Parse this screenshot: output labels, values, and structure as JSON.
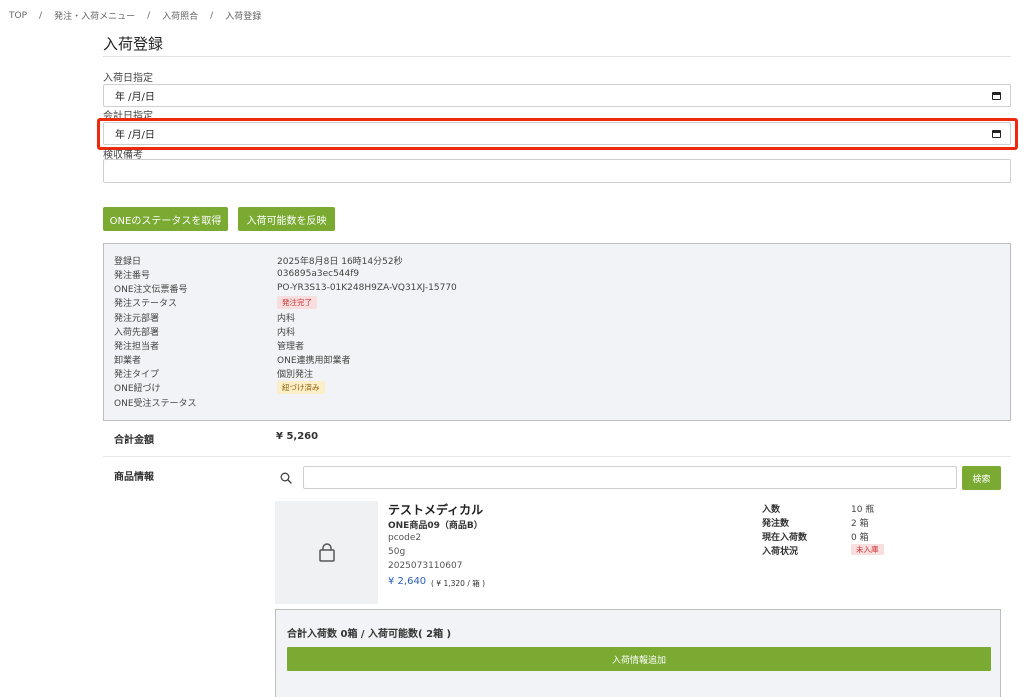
{
  "breadcrumb": {
    "items": [
      "TOP",
      "発注・入荷メニュー",
      "入荷照合",
      "入荷登録"
    ],
    "separator": "/"
  },
  "page": {
    "title": "入荷登録"
  },
  "form": {
    "arrival_date_label": "入荷日指定",
    "arrival_date_value": "年 /月/日",
    "accounting_date_label": "会計日指定",
    "accounting_date_value": "年 /月/日",
    "inspection_note_label": "検収備考",
    "inspection_note_value": ""
  },
  "actions": {
    "get_status_label": "ONEのステータスを取得",
    "reflect_label": "入荷可能数を反映"
  },
  "info": {
    "rows": [
      {
        "label": "登録日",
        "value": "2025年8月8日 16時14分52秒"
      },
      {
        "label": "発注番号",
        "value": "036895a3ec544f9"
      },
      {
        "label": "ONE注文伝票番号",
        "value": "PO-YR3S13-01K248H9ZA-VQ31XJ-15770"
      },
      {
        "label": "発注ステータス",
        "value": "発注完了"
      },
      {
        "label": "発注元部署",
        "value": "内科"
      },
      {
        "label": "入荷先部署",
        "value": "内科"
      },
      {
        "label": "発注担当者",
        "value": "管理者"
      },
      {
        "label": "卸業者",
        "value": "ONE連携用卸業者"
      },
      {
        "label": "発注タイプ",
        "value": "個別発注"
      },
      {
        "label": "ONE紐づけ",
        "value": "紐づけ済み"
      },
      {
        "label": "ONE受注ステータス",
        "value": ""
      }
    ]
  },
  "total": {
    "label": "合計金額",
    "value": "¥ 5,260"
  },
  "product_section": {
    "label": "商品情報",
    "search_placeholder": "",
    "search_button": "検索"
  },
  "product": {
    "maker": "テストメディカル",
    "name": "ONE商品09（商品B）",
    "code": "pcode2",
    "spec": "50g",
    "jan": "2025073110607",
    "price": "¥ 2,640",
    "unit_price": "( ¥ 1,320 / 箱 )",
    "stats": [
      {
        "label": "入数",
        "value": "10 瓶"
      },
      {
        "label": "発注数",
        "value": "2 箱"
      },
      {
        "label": "現在入荷数",
        "value": "0 箱"
      },
      {
        "label": "入荷状況",
        "value": "未入庫"
      }
    ]
  },
  "arrival_summary": {
    "text": "合計入荷数 0箱 / 入荷可能数( 2箱 )",
    "add_button": "入荷情報追加"
  },
  "colors": {
    "accent_green": "#7aaa32",
    "highlight_red": "#ee2a0e",
    "price_blue": "#2c5fb8"
  }
}
